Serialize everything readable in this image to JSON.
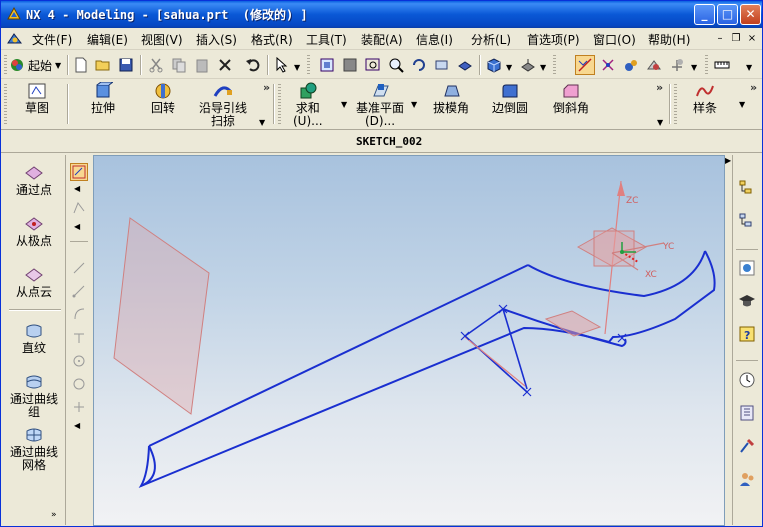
{
  "window": {
    "title": "NX 4 - Modeling - [sahua.prt  (修改的) ]",
    "minimize": "_",
    "maximize": "□",
    "close": "✕"
  },
  "menu": {
    "items": [
      {
        "label": "文件(F)"
      },
      {
        "label": "编辑(E)"
      },
      {
        "label": "视图(V)"
      },
      {
        "label": "插入(S)"
      },
      {
        "label": "格式(R)"
      },
      {
        "label": "工具(T)"
      },
      {
        "label": "装配(A)"
      },
      {
        "label": "信息(I)"
      },
      {
        "label": "分析(L)"
      },
      {
        "label": "首选项(P)"
      },
      {
        "label": "窗口(O)"
      },
      {
        "label": "帮助(H)"
      }
    ],
    "mdi_minimize": "–",
    "mdi_restore": "❐",
    "mdi_close": "×"
  },
  "standard_toolbar": {
    "start_label": "起始",
    "icons": [
      "new-file-icon",
      "open-folder-icon",
      "save-icon",
      "cut-icon",
      "copy-icon",
      "paste-icon",
      "delete-icon",
      "undo-icon",
      "select-filter-icon",
      "fit-icon",
      "zoom-window-icon",
      "zoom-icon",
      "rotate-icon",
      "pan-icon",
      "render-style-icon",
      "shaded-cube-icon",
      "view-orient-icon",
      "selection-intent-icon",
      "snap-point-icon",
      "layer-icon",
      "show-hide-icon",
      "wcs-icon"
    ]
  },
  "feature_toolbar": {
    "sketch": "草图",
    "extrude": "拉伸",
    "revolve": "回转",
    "sweep_line1": "沿导引线",
    "sweep_line2": "扫掠",
    "unite_line1": "求和",
    "unite_line2": "(U)...",
    "datum_line1": "基准平面",
    "datum_line2": "(D)...",
    "draft": "拔模角",
    "edge_blend": "边倒圆",
    "chamfer": "倒斜角",
    "spline": "样条"
  },
  "sketch_name": "SKETCH_002",
  "surface_panel": {
    "through_points": "通过点",
    "from_poles": "从极点",
    "from_point_cloud": "从点云",
    "ruled": "直纹",
    "through_curves_line1": "通过曲线",
    "through_curves_line2": "组",
    "through_curve_mesh_line1": "通过曲线",
    "through_curve_mesh_line2": "网格"
  },
  "viewport": {
    "axis_labels": {
      "z": "ZC",
      "y": "YC",
      "x": "XC"
    }
  },
  "colors": {
    "title_blue": "#0a58d6",
    "curve_blue": "#1a2fd0",
    "datum_pink": "#e08080",
    "wcs_green": "#20a040",
    "wcs_red": "#e02020"
  }
}
